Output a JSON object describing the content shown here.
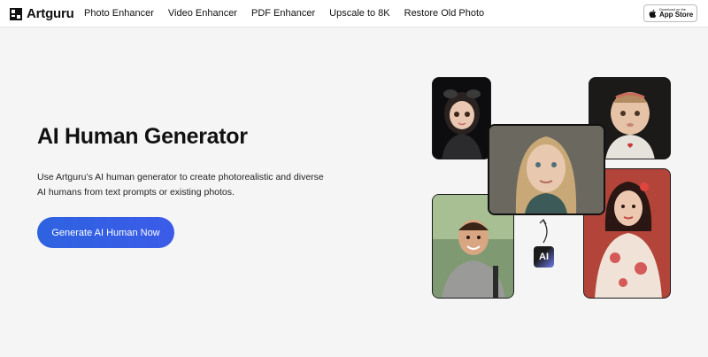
{
  "header": {
    "brand": "Artguru",
    "nav": [
      {
        "label": "Photo Enhancer"
      },
      {
        "label": "Video Enhancer"
      },
      {
        "label": "PDF Enhancer"
      },
      {
        "label": "Upscale to 8K"
      },
      {
        "label": "Restore Old Photo"
      }
    ],
    "app_store": {
      "small": "Download on the",
      "big": "App Store"
    }
  },
  "hero": {
    "title": "AI Human Generator",
    "description": "Use Artguru’s AI human generator to create photorealistic and diverse AI humans from text prompts or existing photos.",
    "cta_label": "Generate AI Human Now"
  },
  "collage": {
    "ai_badge": "AI"
  },
  "colors": {
    "accent": "#2e63e0",
    "background": "#f5f5f6"
  }
}
